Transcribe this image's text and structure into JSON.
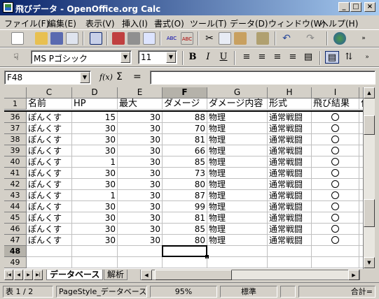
{
  "window": {
    "title": "飛びデータ - OpenOffice.org Calc"
  },
  "menu": [
    "ファイル(F)",
    "編集(E)",
    "表示(V)",
    "挿入(I)",
    "書式(O)",
    "ツール(T)",
    "データ(D)",
    "ウィンドウ(W)",
    "ヘルプ(H)"
  ],
  "format_toolbar": {
    "font_name": "MS Pゴシック",
    "font_size": "11",
    "bold": "B",
    "italic": "I",
    "underline": "U"
  },
  "formula_bar": {
    "cell_ref": "F48",
    "func_label": "f(x)",
    "sum_label": "Σ",
    "equals_label": "=",
    "value": ""
  },
  "columns": [
    "C",
    "D",
    "E",
    "F",
    "G",
    "H",
    "I"
  ],
  "selected_column": "F",
  "header_row": {
    "row": "1",
    "cells": [
      "名前",
      "HP",
      "最大",
      "ダメージ",
      "ダメージ内容",
      "形式",
      "飛び結果",
      "位"
    ]
  },
  "rows": [
    {
      "row": "36",
      "name": "ぽんくす",
      "hp": "15",
      "max": "30",
      "damage": "88",
      "type": "物理",
      "form": "通常戦闘"
    },
    {
      "row": "37",
      "name": "ぽんくす",
      "hp": "30",
      "max": "30",
      "damage": "70",
      "type": "物理",
      "form": "通常戦闘"
    },
    {
      "row": "38",
      "name": "ぽんくす",
      "hp": "30",
      "max": "30",
      "damage": "81",
      "type": "物理",
      "form": "通常戦闘"
    },
    {
      "row": "39",
      "name": "ぽんくす",
      "hp": "30",
      "max": "30",
      "damage": "66",
      "type": "物理",
      "form": "通常戦闘"
    },
    {
      "row": "40",
      "name": "ぽんくす",
      "hp": "1",
      "max": "30",
      "damage": "85",
      "type": "物理",
      "form": "通常戦闘"
    },
    {
      "row": "41",
      "name": "ぽんくす",
      "hp": "30",
      "max": "30",
      "damage": "73",
      "type": "物理",
      "form": "通常戦闘"
    },
    {
      "row": "42",
      "name": "ぽんくす",
      "hp": "30",
      "max": "30",
      "damage": "80",
      "type": "物理",
      "form": "通常戦闘"
    },
    {
      "row": "43",
      "name": "ぽんくす",
      "hp": "1",
      "max": "30",
      "damage": "87",
      "type": "物理",
      "form": "通常戦闘"
    },
    {
      "row": "44",
      "name": "ぽんくす",
      "hp": "30",
      "max": "30",
      "damage": "99",
      "type": "物理",
      "form": "通常戦闘"
    },
    {
      "row": "45",
      "name": "ぽんくす",
      "hp": "30",
      "max": "30",
      "damage": "81",
      "type": "物理",
      "form": "通常戦闘"
    },
    {
      "row": "46",
      "name": "ぽんくす",
      "hp": "30",
      "max": "30",
      "damage": "85",
      "type": "物理",
      "form": "通常戦闘"
    },
    {
      "row": "47",
      "name": "ぽんくす",
      "hp": "30",
      "max": "30",
      "damage": "80",
      "type": "物理",
      "form": "通常戦闘"
    }
  ],
  "result_symbol": "circle",
  "empty_rows": [
    "48",
    "49"
  ],
  "selected_row": "48",
  "sheet_tabs": [
    "データベース",
    "解析"
  ],
  "active_tab": "データベース",
  "status": {
    "sheet": "表 1 / 2",
    "page_style": "PageStyle_データベース",
    "zoom": "95%",
    "mode": "標準",
    "sum": "合計="
  },
  "colors": {
    "title_start": "#0a246a",
    "title_end": "#a6caf0",
    "face": "#d4d0c8"
  }
}
